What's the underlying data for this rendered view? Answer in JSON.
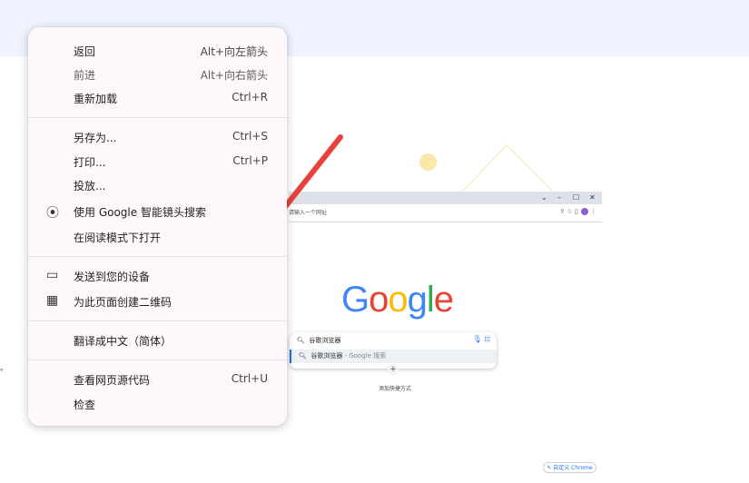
{
  "context_menu": {
    "back": {
      "label": "返回",
      "shortcut": "Alt+向左箭头"
    },
    "forward": {
      "label": "前进",
      "shortcut": "Alt+向右箭头"
    },
    "reload": {
      "label": "重新加载",
      "shortcut": "Ctrl+R"
    },
    "save_as": {
      "label": "另存为...",
      "shortcut": "Ctrl+S"
    },
    "print": {
      "label": "打印...",
      "shortcut": "Ctrl+P"
    },
    "cast": {
      "label": "投放..."
    },
    "lens": {
      "label": "使用 Google 智能镜头搜索",
      "icon": "lens-icon"
    },
    "reading_mode": {
      "label": "在阅读模式下打开"
    },
    "send_to_devices": {
      "label": "发送到您的设备",
      "icon": "devices-icon"
    },
    "qr_code": {
      "label": "为此页面创建二维码",
      "icon": "qr-code-icon"
    },
    "translate": {
      "label": "翻译成中文（简体）"
    },
    "view_source": {
      "label": "查看网页源代码",
      "shortcut": "Ctrl+U"
    },
    "inspect": {
      "label": "检查"
    }
  },
  "background": {
    "mini_address_placeholder": "请输入一个网址",
    "google_logo": {
      "G": "G",
      "o1": "o",
      "o2": "o",
      "g": "g",
      "l": "l",
      "e": "e"
    },
    "mini_search_query": "谷歌浏览器",
    "mini_suggestion_main": "谷歌浏览器",
    "mini_suggestion_suffix": " - Google 搜索",
    "mini_add_shortcut_label": "添加快捷方式",
    "customize_label": "自定义 Chrome",
    "left_edge_char": "。",
    "window_controls": [
      "⌄",
      "–",
      "☐",
      "✕"
    ]
  },
  "colors": {
    "arrow": "#e8413c",
    "menu_bg": "#fdf7fa",
    "topband": "#eef3fd"
  }
}
